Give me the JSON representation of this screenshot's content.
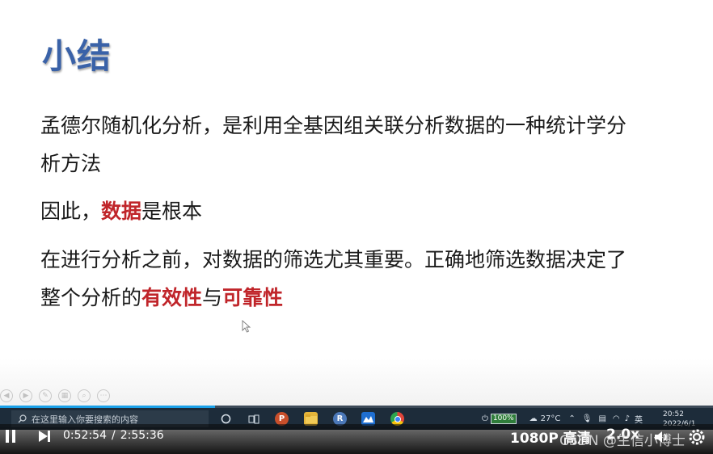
{
  "slide": {
    "title": "小结",
    "p1_line1": "孟德尔随机化分析，是利用全基因组关联分析数据的一种统计学分",
    "p1_line2": "析方法",
    "p2_pre": "因此，",
    "p2_red": "数据",
    "p2_post": "是根本",
    "p3_line1": "在进行分析之前，对数据的筛选尤其重要。正确地筛选数据决定了",
    "p3_pre": "整个分析的",
    "p3_red1": "有效性",
    "p3_mid": "与",
    "p3_red2": "可靠性"
  },
  "taskbar": {
    "search_placeholder": "在这里输入你要搜索的内容",
    "apps": [
      "cortana-icon",
      "task-view-icon",
      "powerpoint-icon",
      "file-explorer-icon",
      "r-icon",
      "app-icon",
      "chrome-icon"
    ],
    "battery": "100%",
    "weather": "27°C",
    "ime": "英",
    "time": "20:52",
    "date": "2022/6/1"
  },
  "player": {
    "current_time": "0:52:54",
    "separator": "/",
    "total_time": "2:55:36",
    "progress": 0.3014,
    "quality": "1080P 高清",
    "speed": "2.0x",
    "watermark": "CSDN @生信小博士"
  },
  "colors": {
    "title": "#3a62a8",
    "emphasis": "#c0252a",
    "taskbar": "#1d2c3a",
    "progress": "#1aa0e8"
  }
}
